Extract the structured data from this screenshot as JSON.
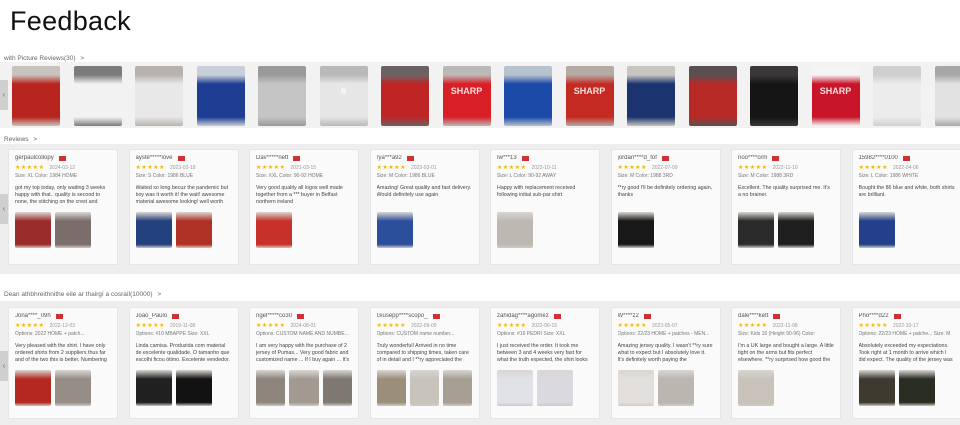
{
  "page": {
    "title": "Feedback"
  },
  "picture_section": {
    "label": "with Picture Reviews(30)",
    "chevron": ">"
  },
  "photos": [
    {
      "bg": "#c8c3bc",
      "fg": "#b8241e",
      "mark": ""
    },
    {
      "bg": "#7b7b7b",
      "fg": "#f2f2f2",
      "mark": ""
    },
    {
      "bg": "#b7b2ad",
      "fg": "#e8e8e8",
      "mark": ""
    },
    {
      "bg": "#c9cfd9",
      "fg": "#1d3e93",
      "mark": ""
    },
    {
      "bg": "#9a9a9a",
      "fg": "#c5c5c5",
      "mark": ""
    },
    {
      "bg": "#b9b9b9",
      "fg": "#e6e6e6",
      "mark": "6"
    },
    {
      "bg": "#6b6363",
      "fg": "#c02525",
      "mark": ""
    },
    {
      "bg": "#bbb9b8",
      "fg": "#d81f26",
      "mark": "SHARP"
    },
    {
      "bg": "#b7c2cf",
      "fg": "#1c4aa8",
      "mark": ""
    },
    {
      "bg": "#b6aaa5",
      "fg": "#c52a22",
      "mark": "SHARP"
    },
    {
      "bg": "#c9c5c0",
      "fg": "#1b3470",
      "mark": ""
    },
    {
      "bg": "#595151",
      "fg": "#b82a26",
      "mark": ""
    },
    {
      "bg": "#3a3838",
      "fg": "#151515",
      "mark": ""
    },
    {
      "bg": "#f4f4f4",
      "fg": "#c9152a",
      "mark": "SHARP"
    },
    {
      "bg": "#cfcfcf",
      "fg": "#ececec",
      "mark": ""
    },
    {
      "bg": "#a7a7a7",
      "fg": "#e2e2e2",
      "mark": ""
    }
  ],
  "reviews_section": {
    "label": "Reviews",
    "chevron": ">"
  },
  "reviews": [
    {
      "user": "gerpaulcollopy",
      "date": "2024-03-12",
      "meta": "Size: XL    Color: 1984 HOME",
      "text": "got my top today, only waiting 3 weeks happy with that.. quality is second to none, the stitching on the crest and",
      "thumbs": [
        "#9b2c2c",
        "#7a6d6a"
      ]
    },
    {
      "user": "ayste*****love",
      "date": "2023-03-18",
      "meta": "Size: S    Color: 1986 BLUE",
      "text": "Waited so long becuz the pandemic but boy was it worth it! the wait! awesome material awesome looking! well worth",
      "thumbs": [
        "#23407f",
        "#b03225"
      ]
    },
    {
      "user": "Dav*****nett",
      "date": "2021-03-15",
      "meta": "Size: XXL    Color: 90-92 HOME",
      "text": "Very good quality all logos well made together from a *** buyer in Belfast northern ireland",
      "thumbs": [
        "#c8312a"
      ]
    },
    {
      "user": "rya***a92",
      "date": "2023-03-01",
      "meta": "Size: M    Color: 1986 BLUE",
      "text": "Amazing! Great quality and fast delivery. Would definitely use again",
      "thumbs": [
        "#2c4f9c"
      ]
    },
    {
      "user": "Iw***13",
      "date": "2023-10-11",
      "meta": "Size: L    Color: 90-92 AWAY",
      "text": "Happy with replacement received following initial sub-par shirt",
      "thumbs": [
        "#bdb8b2"
      ]
    },
    {
      "user": "jordan****d_fof",
      "date": "2022-07-09",
      "meta": "Size: M    Color: 1988 3RD",
      "text": "**ry good I'll be definitely ordering again, thanks",
      "thumbs": [
        "#181818"
      ]
    },
    {
      "user": "noo****o/m",
      "date": "2022-11-10",
      "meta": "Size: M    Color: 1988 3RD",
      "text": "Excellent. The quality surprised me. It's a no brainer.",
      "thumbs": [
        "#2b2b2b",
        "#1f1f1f"
      ]
    },
    {
      "user": "15982****0100",
      "date": "2022-04-06",
      "meta": "Size: L    Color: 1986 WHITE",
      "text": "Bought the 86 blue and white, both shirts are brilliant.",
      "thumbs": [
        "#24408a"
      ]
    }
  ],
  "translated_section": {
    "label": "Dean athbhreithnithe eile ar thairgí a cosraíl(10000)",
    "chevron": ">"
  },
  "reviews2": [
    {
      "user": "Jona****_09h",
      "date": "2022-12-03",
      "meta": "Options: 2022 HOME + patch...",
      "text": "Very pleased with the shirt. I have only ordered shirts from 2 suppliers thus far and of the two this is better. Numbering",
      "thumbs": [
        "#b4281f",
        "#968d86"
      ]
    },
    {
      "user": "Joao_Paulo",
      "date": "2019-11-08",
      "meta": "Options: #10 MBAPPE    Size: XXL",
      "text": "Linda camisa. Produzida com material de excelente qualidade. O tamanho que escolhi ficou ótimo. Excelente vendedor.",
      "thumbs": [
        "#202020",
        "#121212"
      ]
    },
    {
      "user": "ngel*****co30",
      "date": "2024-08-01",
      "meta": "Options: CUSTOM NAME AND NUMBE...",
      "text": "I am very happy with the purchase of 2 jersey of Pumas... Very good fabric and customized name ... If I buy again ... It's",
      "thumbs": [
        "#8e857c",
        "#a29a90",
        "#7f7870"
      ]
    },
    {
      "user": "Giusepp****scopo_",
      "date": "2022-09-09",
      "meta": "Options: CUSTOM name number...",
      "text": "Truly wonderful! Arrived in no time compared to shipping times, taken care of in detail and I **ry appreciated the",
      "thumbs": [
        "#9b8f7a",
        "#c8c3bb",
        "#a79f92"
      ]
    },
    {
      "user": "zahidag****agomez",
      "date": "2022-06-15",
      "meta": "Options: #16 PEDRI    Size: XXL",
      "text": "I just received the order. It took me between 3 and 4 weeks very fast for what the truth expected, the shirt looks",
      "thumbs": [
        "#e1e1e8",
        "#dad9e0"
      ]
    },
    {
      "user": "W****z2",
      "date": "2023-05-07",
      "meta": "Options: 22/23 HOME + patches - MEN...",
      "text": "Amazing jersey quality. I wasn't **ry sure what to expect but I absolutely love it. It's definitely worth paying the",
      "thumbs": [
        "#e2dfdc",
        "#bcb6b0"
      ]
    },
    {
      "user": "dale****kett",
      "date": "2022-11-08",
      "meta": "Size: Kids 16 (Height 90-96)    Color:",
      "text": "I'm a UK large and bought a large. A little tight on the arms but fits perfect elsewhere. **ry surprised how good the",
      "thumbs": [
        "#c9c2ba"
      ]
    },
    {
      "user": "Pho****d22",
      "date": "2022-10-17",
      "meta": "Options: 22/23 HOME + patche...    Size: M",
      "text": "Absolutely exceeded my expectations. Took right at 1 month to arrive which I did expect. The quality of the jersey was",
      "thumbs": [
        "#3e3a30",
        "#2a2d22"
      ]
    }
  ],
  "icons": {
    "star": "★",
    "left": "‹",
    "right": "›"
  },
  "colors": {
    "star": "#f5b800"
  }
}
